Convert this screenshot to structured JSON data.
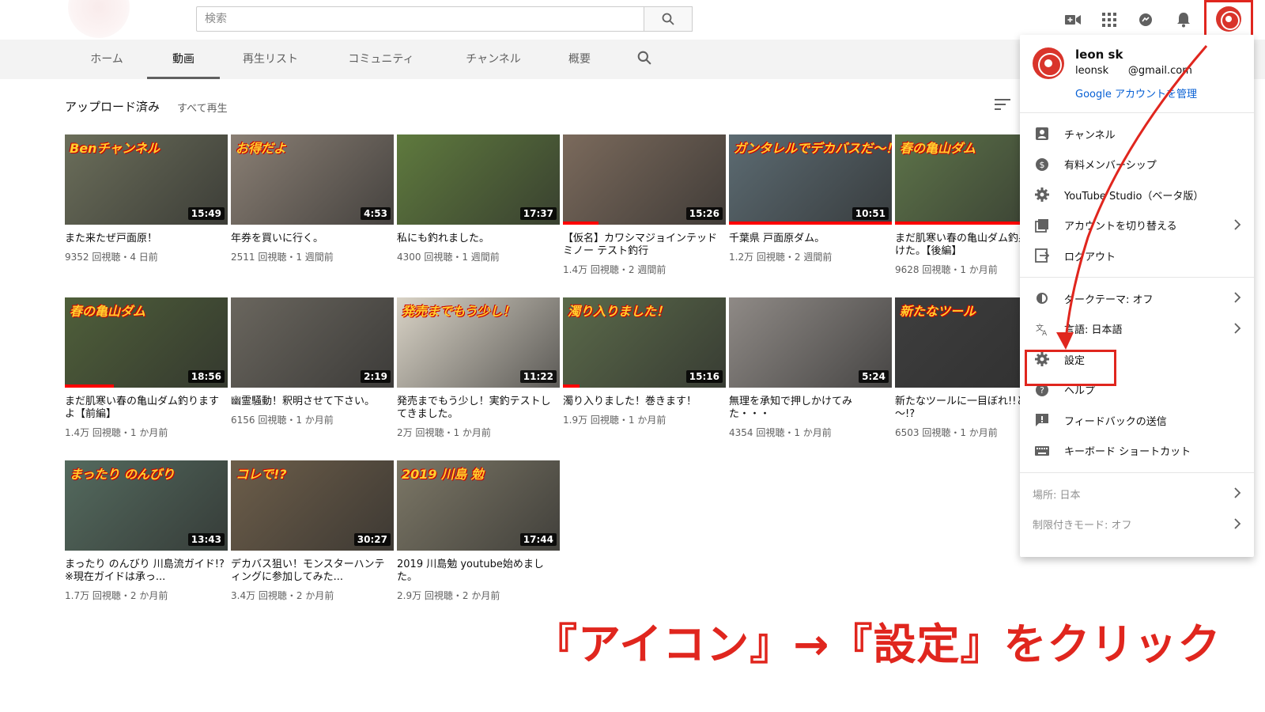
{
  "header": {
    "search_placeholder": "検索"
  },
  "tabs": [
    {
      "label": "ホーム"
    },
    {
      "label": "動画"
    },
    {
      "label": "再生リスト"
    },
    {
      "label": "コミュニティ"
    },
    {
      "label": "チャンネル"
    },
    {
      "label": "概要"
    }
  ],
  "section": {
    "title": "アップロード済み",
    "play_all": "すべて再生"
  },
  "videos": [
    {
      "title": "また来たぜ戸面原！",
      "meta": "9352 回視聴・4 日前",
      "duration": "15:49",
      "progress": 0.0,
      "bg": "#6b6e5a",
      "overlay": "Benチャンネル"
    },
    {
      "title": "年券を買いに行く。",
      "meta": "2511 回視聴・1 週間前",
      "duration": "4:53",
      "progress": 0.0,
      "bg": "#8a7f74",
      "overlay": "お得だよ"
    },
    {
      "title": "私にも釣れました。",
      "meta": "4300 回視聴・1 週間前",
      "duration": "17:37",
      "progress": 0.0,
      "bg": "#5f7a3e",
      "overlay": ""
    },
    {
      "title": "【仮名】カワシマジョインテッドミノー テスト釣行",
      "meta": "1.4万 回視聴・2 週間前",
      "duration": "15:26",
      "progress": 0.22,
      "bg": "#7b6a5c",
      "overlay": ""
    },
    {
      "title": "千葉県 戸面原ダム。",
      "meta": "1.2万 回視聴・2 週間前",
      "duration": "10:51",
      "progress": 1.0,
      "bg": "#5c6b72",
      "overlay": "ガンタレルでデカバスだ～！"
    },
    {
      "title": "まだ肌寒い春の亀山ダム釣果みつけた。【後編】",
      "meta": "9628 回視聴・1 か月前",
      "duration": "",
      "progress": 1.0,
      "bg": "#5d7349",
      "overlay": "春の亀山ダム"
    },
    {
      "title": "まだ肌寒い春の亀山ダム釣りますよ【前編】",
      "meta": "1.4万 回視聴・1 か月前",
      "duration": "18:56",
      "progress": 0.3,
      "bg": "#4f5f3a",
      "overlay": "春の亀山ダム"
    },
    {
      "title": "幽霊騒動！釈明させて下さい。",
      "meta": "6156 回視聴・1 か月前",
      "duration": "2:19",
      "progress": 0.0,
      "bg": "#6a665e",
      "overlay": ""
    },
    {
      "title": "発売までもう少し！実釣テストしてきました。",
      "meta": "2万 回視聴・1 か月前",
      "duration": "11:22",
      "progress": 0.0,
      "bg": "#d9d3c6",
      "overlay": "発売までもう少し！"
    },
    {
      "title": "濁り入りました！巻きます！",
      "meta": "1.9万 回視聴・1 か月前",
      "duration": "15:16",
      "progress": 0.1,
      "bg": "#5b6a4a",
      "overlay": "濁り入りました！"
    },
    {
      "title": "無理を承知で押しかけてみた・・・",
      "meta": "4354 回視聴・1 か月前",
      "duration": "5:24",
      "progress": 0.0,
      "bg": "#8f8a86",
      "overlay": ""
    },
    {
      "title": "新たなツールに一目ぼれ!!となだね～!?",
      "meta": "6503 回視聴・1 か月前",
      "duration": "",
      "progress": 0.0,
      "bg": "#3e3e3e",
      "overlay": "新たなツール"
    },
    {
      "title": "まったり のんびり 川島流ガイド!? ※現在ガイドは承っ...",
      "meta": "1.7万 回視聴・2 か月前",
      "duration": "13:43",
      "progress": 0.0,
      "bg": "#546a5e",
      "overlay": "まったり のんびり"
    },
    {
      "title": "デカバス狙い！モンスターハンティングに参加してみた...",
      "meta": "3.4万 回視聴・2 か月前",
      "duration": "30:27",
      "progress": 0.0,
      "bg": "#6d5e4a",
      "overlay": "コレで!?"
    },
    {
      "title": "2019 川島勉 youtube始めました。",
      "meta": "2.9万 回視聴・2 か月前",
      "duration": "17:44",
      "progress": 0.0,
      "bg": "#7c7766",
      "overlay": "2019 川島 勉"
    }
  ],
  "account_menu": {
    "name": "leon sk",
    "email": "leonsk      @gmail.com",
    "manage": "Google アカウントを管理",
    "group1": [
      {
        "label": "チャンネル",
        "icon": "person-icon",
        "chevron": false
      },
      {
        "label": "有料メンバーシップ",
        "icon": "dollar-icon",
        "chevron": false
      },
      {
        "label": "YouTube Studio（ベータ版）",
        "icon": "gear-icon",
        "chevron": false
      },
      {
        "label": "アカウントを切り替える",
        "icon": "switch-account-icon",
        "chevron": true
      },
      {
        "label": "ログアウト",
        "icon": "logout-icon",
        "chevron": false
      }
    ],
    "group2": [
      {
        "label": "ダークテーマ: オフ",
        "icon": "dark-theme-icon",
        "chevron": true
      },
      {
        "label": "言語: 日本語",
        "icon": "translate-icon",
        "chevron": true
      },
      {
        "label": "設定",
        "icon": "gear-icon",
        "chevron": false
      },
      {
        "label": "ヘルプ",
        "icon": "help-icon",
        "chevron": false
      },
      {
        "label": "フィードバックの送信",
        "icon": "feedback-icon",
        "chevron": false
      },
      {
        "label": "キーボード ショートカット",
        "icon": "keyboard-icon",
        "chevron": false
      }
    ],
    "group3": [
      {
        "label": "場所: 日本",
        "chevron": true
      },
      {
        "label": "制限付きモード: オフ",
        "chevron": true
      }
    ]
  },
  "annotation": {
    "caption": "『アイコン』→『設定』をクリック",
    "color": "#e0261e"
  }
}
